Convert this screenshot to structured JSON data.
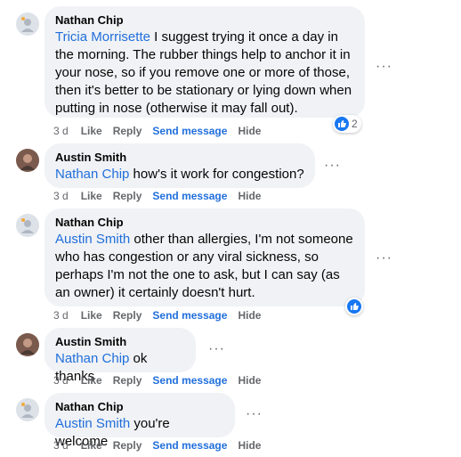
{
  "comments": [
    {
      "author": "Nathan Chip",
      "mention": "Tricia Morrisette",
      "lines_text": " I suggest trying it once a day in the morning. The rubber things help to anchor it in your nose, so if you remove one or more of those, then it's better to be stationary or lying down when putting in nose (otherwise it may fall out).",
      "time": "3 d",
      "reaction_count": "2"
    },
    {
      "author": "Austin Smith",
      "mention": "Nathan Chip",
      "text": " how's it work for congestion?",
      "time": "3 d"
    },
    {
      "author": "Nathan Chip",
      "mention": "Austin Smith",
      "text": " other than allergies, I'm not someone who has congestion or any viral sickness, so perhaps I'm not the one to ask, but I can say (as an owner) it certainly doesn't hurt.",
      "time": "3 d"
    },
    {
      "author": "Austin Smith",
      "mention": "Nathan Chip",
      "text": " ok thanks",
      "time": "3 d"
    },
    {
      "author": "Nathan Chip",
      "mention": "Austin Smith",
      "text": " you're welcome",
      "time": "3 d"
    }
  ],
  "actions": {
    "like": "Like",
    "reply": "Reply",
    "send_message": "Send message",
    "hide": "Hide"
  },
  "more_icon": "···"
}
